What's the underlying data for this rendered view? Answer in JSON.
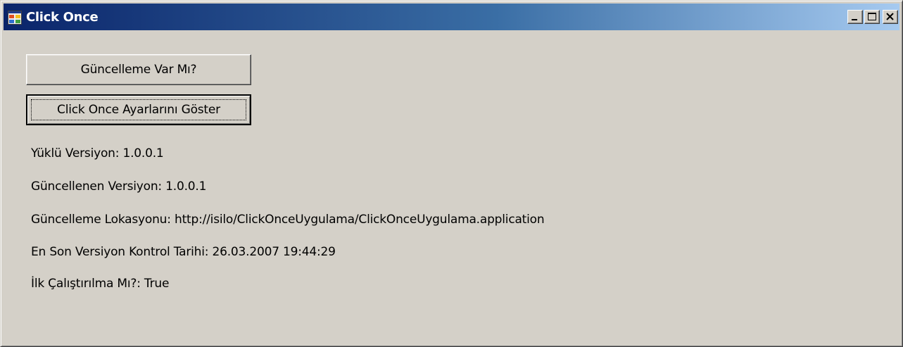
{
  "window": {
    "title": "Click Once",
    "app_icon": "winforms-app-icon",
    "controls": {
      "minimize_icon": "minimize-icon",
      "maximize_icon": "maximize-icon",
      "close_icon": "close-icon"
    }
  },
  "buttons": {
    "check_update_label": "Güncelleme Var Mı?",
    "show_settings_label": "Click Once Ayarlarını Göster"
  },
  "info": {
    "installed_version": "Yüklü Versiyon: 1.0.0.1",
    "updated_version": "Güncellenen Versiyon: 1.0.0.1",
    "update_location": "Güncelleme Lokasyonu: http://isilo/ClickOnceUygulama/ClickOnceUygulama.application",
    "last_check_date": "En Son Versiyon Kontrol Tarihi: 26.03.2007 19:44:29",
    "first_run": "İlk Çalıştırılma Mı?: True"
  },
  "colors": {
    "titlebar_start": "#0a246a",
    "titlebar_end": "#a6caf0",
    "window_bg": "#d4d0c8"
  }
}
